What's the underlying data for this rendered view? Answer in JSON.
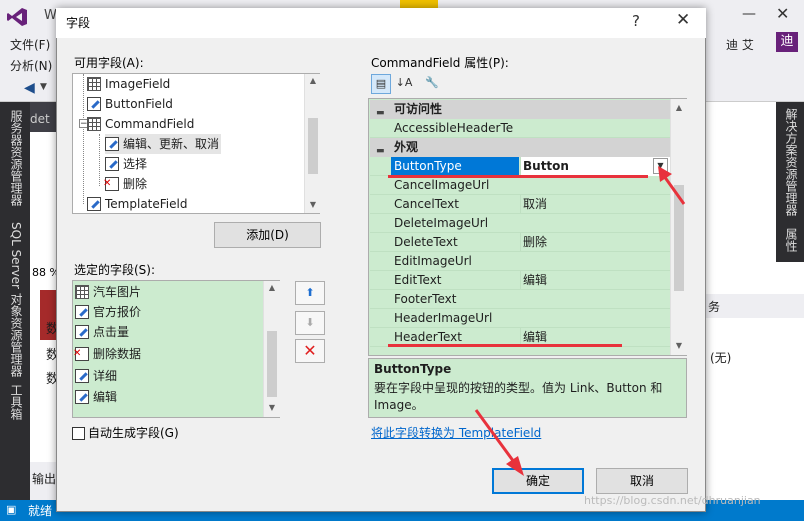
{
  "background": {
    "title_fragment": "W",
    "menus": [
      "文件(F)",
      "分析(N)"
    ],
    "user_name": "迪 艾",
    "user_initial": "迪",
    "editor_tab": "det",
    "left_tool_tabs": [
      "服务器资源管理器",
      "SQL Server 对象资源管理器",
      "工具箱"
    ],
    "right_tool_tabs": [
      "解决方案资源管理器",
      "属性"
    ],
    "zoom": "88 %",
    "editor_chars": [
      "数",
      "数",
      "数"
    ],
    "output_tab": "输出",
    "right_panel_label": "务",
    "right_panel_value": "(无)",
    "status_text": "就绪"
  },
  "dialog": {
    "title": "字段",
    "help_glyph": "?",
    "close_glyph": "✕",
    "available_label": "可用字段(A):",
    "available_fields": [
      {
        "label": "ImageField",
        "icon": "image-field-icon"
      },
      {
        "label": "ButtonField",
        "icon": "button-field-icon"
      },
      {
        "label": "CommandField",
        "icon": "command-field-icon"
      },
      {
        "label": "编辑、更新、取消",
        "icon": "edit-field-icon"
      },
      {
        "label": "选择",
        "icon": "select-field-icon"
      },
      {
        "label": "删除",
        "icon": "delete-field-icon"
      },
      {
        "label": "TemplateField",
        "icon": "template-field-icon"
      }
    ],
    "add_button": "添加(D)",
    "selected_label": "选定的字段(S):",
    "selected_fields": [
      {
        "label": "汽车图片",
        "icon": "image-field-icon"
      },
      {
        "label": "官方报价",
        "icon": "bound-field-icon"
      },
      {
        "label": "点击量",
        "icon": "bound-field-icon"
      },
      {
        "label": "删除数据",
        "icon": "delete-field-icon"
      },
      {
        "label": "详细",
        "icon": "hyperlink-field-icon"
      },
      {
        "label": "编辑",
        "icon": "edit-field-icon"
      }
    ],
    "auto_generate_label": "自动生成字段(G)",
    "auto_generate_checked": false,
    "properties_label": "CommandField 属性(P):",
    "categories": [
      {
        "name": "可访问性",
        "properties": [
          {
            "name": "AccessibleHeaderTe",
            "value": ""
          }
        ]
      },
      {
        "name": "外观",
        "properties": [
          {
            "name": "ButtonType",
            "value": "Button",
            "selected": true
          },
          {
            "name": "CancelImageUrl",
            "value": ""
          },
          {
            "name": "CancelText",
            "value": "取消"
          },
          {
            "name": "DeleteImageUrl",
            "value": ""
          },
          {
            "name": "DeleteText",
            "value": "删除"
          },
          {
            "name": "EditImageUrl",
            "value": ""
          },
          {
            "name": "EditText",
            "value": "编辑"
          },
          {
            "name": "FooterText",
            "value": ""
          },
          {
            "name": "HeaderImageUrl",
            "value": ""
          },
          {
            "name": "HeaderText",
            "value": "编辑"
          }
        ]
      }
    ],
    "description_title": "ButtonType",
    "description_text": "要在字段中呈现的按钮的类型。值为 Link、Button 和 Image。",
    "convert_link": "将此字段转换为 TemplateField",
    "ok_button": "确定",
    "cancel_button": "取消"
  },
  "watermark": "https://blog.csdn.net/dhruanjian",
  "colors": {
    "list_background": "#ccebcf",
    "selection": "#0078d7",
    "annotation_red": "#e8323c",
    "vs_blue": "#007acc"
  }
}
